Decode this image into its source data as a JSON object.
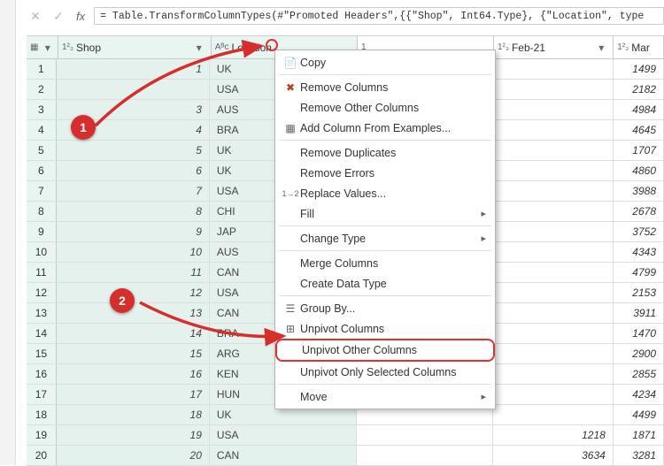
{
  "formula": "= Table.TransformColumnTypes(#\"Promoted Headers\",{{\"Shop\", Int64.Type}, {\"Location\", type",
  "header": {
    "row_icon": "▦",
    "shop_type": "1²₃",
    "shop": "Shop",
    "loc_type": "Aᴮc",
    "loc": "Location",
    "feb_type": "1²₃",
    "feb": "Feb-21",
    "mar_type": "1²₃",
    "mar": "Mar"
  },
  "rows": [
    {
      "i": "1",
      "shop": "1",
      "loc": "UK",
      "gap": "",
      "feb": "",
      "mar": "1499"
    },
    {
      "i": "2",
      "shop": "",
      "loc": "USA",
      "gap": "",
      "feb": "",
      "mar": "2182"
    },
    {
      "i": "3",
      "shop": "3",
      "loc": "AUS",
      "gap": "",
      "feb": "",
      "mar": "4984"
    },
    {
      "i": "4",
      "shop": "4",
      "loc": "BRA",
      "gap": "",
      "feb": "",
      "mar": "4645"
    },
    {
      "i": "5",
      "shop": "5",
      "loc": "UK",
      "gap": "",
      "feb": "",
      "mar": "1707"
    },
    {
      "i": "6",
      "shop": "6",
      "loc": "UK",
      "gap": "",
      "feb": "",
      "mar": "4860"
    },
    {
      "i": "7",
      "shop": "7",
      "loc": "USA",
      "gap": "",
      "feb": "",
      "mar": "3988"
    },
    {
      "i": "8",
      "shop": "8",
      "loc": "CHI",
      "gap": "",
      "feb": "",
      "mar": "2678"
    },
    {
      "i": "9",
      "shop": "9",
      "loc": "JAP",
      "gap": "",
      "feb": "",
      "mar": "3752"
    },
    {
      "i": "10",
      "shop": "10",
      "loc": "AUS",
      "gap": "",
      "feb": "",
      "mar": "4343"
    },
    {
      "i": "11",
      "shop": "11",
      "loc": "CAN",
      "gap": "",
      "feb": "",
      "mar": "4799"
    },
    {
      "i": "12",
      "shop": "12",
      "loc": "USA",
      "gap": "",
      "feb": "",
      "mar": "2153"
    },
    {
      "i": "13",
      "shop": "13",
      "loc": "CAN",
      "gap": "",
      "feb": "",
      "mar": "3911"
    },
    {
      "i": "14",
      "shop": "14",
      "loc": "BRA",
      "gap": "",
      "feb": "",
      "mar": "1470"
    },
    {
      "i": "15",
      "shop": "15",
      "loc": "ARG",
      "gap": "",
      "feb": "",
      "mar": "2900"
    },
    {
      "i": "16",
      "shop": "16",
      "loc": "KEN",
      "gap": "",
      "feb": "",
      "mar": "2855"
    },
    {
      "i": "17",
      "shop": "17",
      "loc": "HUN",
      "gap": "",
      "feb": "",
      "mar": "4234"
    },
    {
      "i": "18",
      "shop": "18",
      "loc": "UK",
      "gap": "",
      "feb": "",
      "mar": "4499"
    },
    {
      "i": "19",
      "shop": "19",
      "loc": "USA",
      "gap": "",
      "feb": "1218",
      "mar": "1871"
    },
    {
      "i": "20",
      "shop": "20",
      "loc": "CAN",
      "gap": "",
      "feb": "3634",
      "mar": "3281"
    }
  ],
  "menu": {
    "copy": "Copy",
    "remove": "Remove Columns",
    "remove_other": "Remove Other Columns",
    "add_example": "Add Column From Examples...",
    "dup": "Remove Duplicates",
    "errors": "Remove Errors",
    "replace": "Replace Values...",
    "fill": "Fill",
    "change_type": "Change Type",
    "merge": "Merge Columns",
    "create_dt": "Create Data Type",
    "group": "Group By...",
    "unpivot": "Unpivot Columns",
    "unpivot_other": "Unpivot Other Columns",
    "unpivot_sel": "Unpivot Only Selected Columns",
    "move": "Move"
  },
  "callouts": {
    "b1": "1",
    "b2": "2"
  }
}
